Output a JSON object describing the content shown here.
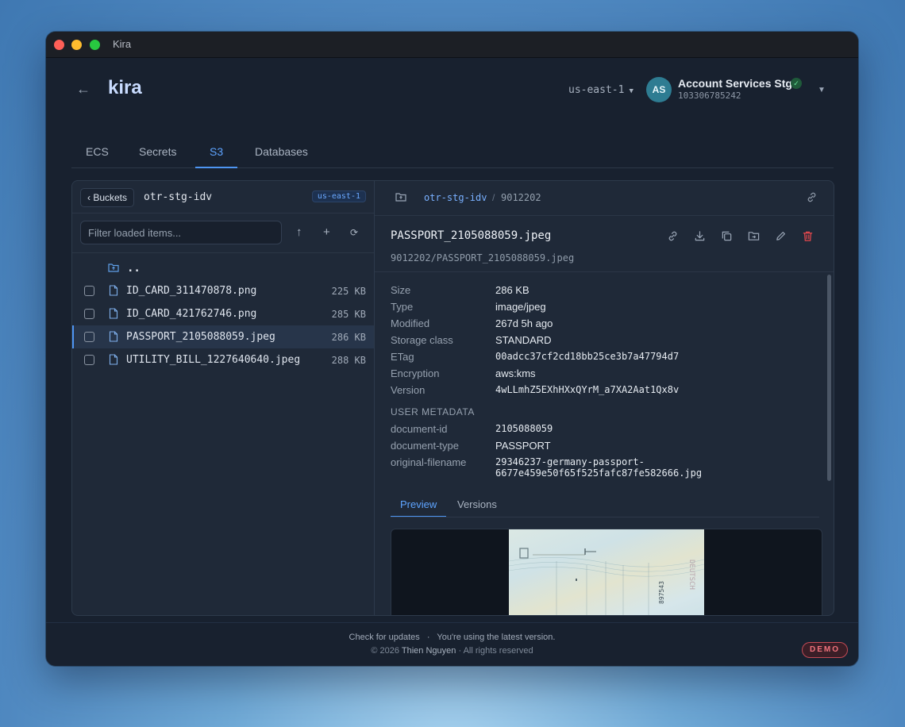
{
  "window": {
    "title": "Kira"
  },
  "header": {
    "brand": "kira",
    "region": "us-east-1",
    "account": {
      "initials": "AS",
      "name": "Account Services Stg",
      "id": "103306785242"
    }
  },
  "tabs": [
    {
      "label": "ECS"
    },
    {
      "label": "Secrets"
    },
    {
      "label": "S3",
      "active": true
    },
    {
      "label": "Databases"
    }
  ],
  "browser": {
    "buckets_label": "‹ Buckets",
    "bucket": "otr-stg-idv",
    "region_badge": "us-east-1",
    "filter_placeholder": "Filter loaded items...",
    "parent_label": "..",
    "files": [
      {
        "name": "ID_CARD_311470878.png",
        "size": "225 KB"
      },
      {
        "name": "ID_CARD_421762746.png",
        "size": "285 KB"
      },
      {
        "name": "PASSPORT_2105088059.jpeg",
        "size": "286 KB",
        "selected": true
      },
      {
        "name": "UTILITY_BILL_1227640640.jpeg",
        "size": "288 KB"
      }
    ]
  },
  "detail": {
    "breadcrumb": {
      "bucket": "otr-stg-idv",
      "separator": "/",
      "prefix": "9012202"
    },
    "title": "PASSPORT_2105088059.jpeg",
    "path": "9012202/PASSPORT_2105088059.jpeg",
    "metadata": [
      {
        "key": "Size",
        "value": "286 KB"
      },
      {
        "key": "Type",
        "value": "image/jpeg"
      },
      {
        "key": "Modified",
        "value": "267d 5h ago"
      },
      {
        "key": "Storage class",
        "value": "STANDARD"
      },
      {
        "key": "ETag",
        "value": "00adcc37cf2cd18bb25ce3b7a47794d7"
      },
      {
        "key": "Encryption",
        "value": "aws:kms"
      },
      {
        "key": "Version",
        "value": "4wLLmhZ5EXhHXxQYrM_a7XA2Aat1Qx8v"
      }
    ],
    "user_metadata_heading": "USER METADATA",
    "user_metadata": [
      {
        "key": "document-id",
        "value": "2105088059"
      },
      {
        "key": "document-type",
        "value": "PASSPORT"
      },
      {
        "key": "original-filename",
        "value": "29346237-germany-passport-",
        "value2": "6677e459e50f65f525fafc87fe582666.jpg"
      }
    ],
    "preview_tabs": [
      {
        "label": "Preview",
        "active": true
      },
      {
        "label": "Versions"
      }
    ],
    "preview_code": "897543"
  },
  "footer": {
    "update_link": "Check for updates",
    "dot": "·",
    "update_status": "You're using the latest version.",
    "copyright_prefix": "© 2026",
    "author": "Thien Nguyen",
    "copyright_suffix": "· All rights reserved",
    "badge": "DEMO"
  },
  "colors": {
    "accent": "#4e95f2",
    "danger": "#e5484d",
    "window_bg": "#18212f"
  }
}
